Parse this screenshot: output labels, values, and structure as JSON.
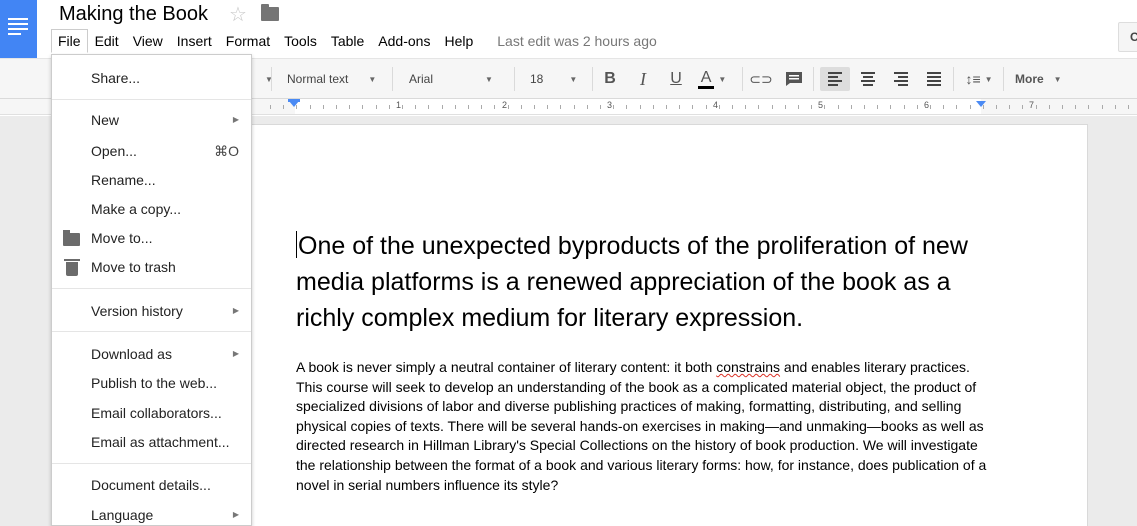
{
  "header": {
    "title": "Making the Book",
    "menu": [
      "File",
      "Edit",
      "View",
      "Insert",
      "Format",
      "Tools",
      "Table",
      "Add-ons",
      "Help"
    ],
    "last_edit": "Last edit was 2 hours ago",
    "right_button_label": "C"
  },
  "toolbar": {
    "style": "Normal text",
    "font": "Arial",
    "size": "18",
    "bold": "B",
    "italic": "I",
    "underline": "U",
    "text_color": "A",
    "more": "More"
  },
  "ruler": {
    "numbers": [
      "1",
      "2",
      "3",
      "4",
      "5",
      "6",
      "7"
    ]
  },
  "file_menu": {
    "items": [
      {
        "label": "Share...",
        "icon": ""
      },
      {
        "label": "New",
        "submenu": true
      },
      {
        "label": "Open...",
        "shortcut": "⌘O"
      },
      {
        "label": "Rename..."
      },
      {
        "label": "Make a copy..."
      },
      {
        "label": "Move to...",
        "icon": "folder-icon"
      },
      {
        "label": "Move to trash",
        "icon": "trash-icon"
      },
      {
        "label": "Version history",
        "submenu": true
      },
      {
        "label": "Download as",
        "submenu": true
      },
      {
        "label": "Publish to the web..."
      },
      {
        "label": "Email collaborators..."
      },
      {
        "label": "Email as attachment..."
      },
      {
        "label": "Document details..."
      },
      {
        "label": "Language",
        "submenu": true
      }
    ]
  },
  "document": {
    "heading": "One of the unexpected byproducts of the proliferation of new media platforms is a renewed appreciation of the book as a richly complex medium for literary expression.",
    "body_before": "A book is never simply a neutral container of literary content: it both ",
    "body_misspelled": "constrains",
    "body_after": " and enables literary practices. This course will seek to develop an understanding of the book as a complicated material object, the product of specialized divisions of labor and diverse publishing practices of making, formatting, distributing, and selling physical copies of texts. There will be several hands-on exercises in making—and unmaking—books as well as directed research in Hillman Library's Special Collections on the history of book production. We will investigate the relationship between the format of a book and various literary forms: how, for instance, does publication of a novel in serial numbers influence its style?"
  },
  "colors": {
    "brand_blue": "#4285f4",
    "menu_border": "#cccccc"
  }
}
